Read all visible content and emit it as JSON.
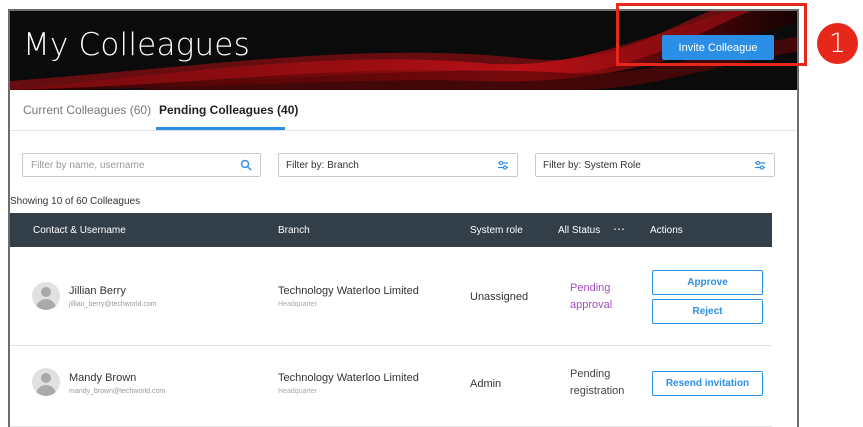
{
  "header": {
    "title": "My Colleagues",
    "invite_button": "Invite Colleague"
  },
  "tabs": [
    {
      "label": "Current Colleagues (60)",
      "active": false
    },
    {
      "label": "Pending Colleagues (40)",
      "active": true
    }
  ],
  "filters": {
    "search_placeholder": "Filter by name, username",
    "branch_label": "Filter by: Branch",
    "role_label": "Filter by: System Role"
  },
  "showing_text": "Showing 10 of 60 Colleagues",
  "table": {
    "columns": [
      "Contact & Username",
      "Branch",
      "System role",
      "All Status",
      "Actions"
    ],
    "status_menu_icon": "ellipsis-icon",
    "rows": [
      {
        "name": "Jillian Berry",
        "email": "jillian_berry@techworld.com",
        "branch": "Technology Waterloo Limited",
        "branch_sub": "Headquarter",
        "role": "Unassigned",
        "status_line1": "Pending",
        "status_line2": "approval",
        "actions": [
          "Approve",
          "Reject"
        ]
      },
      {
        "name": "Mandy Brown",
        "email": "mandy_brown@techworld.com",
        "branch": "Technology Waterloo Limited",
        "branch_sub": "Headquarter",
        "role": "Admin",
        "status_line1": "Pending",
        "status_line2": "registration",
        "actions": [
          "Resend invitation"
        ]
      }
    ]
  },
  "callout": {
    "number": "1"
  },
  "colors": {
    "accent": "#2b8fe6",
    "header_bg": "#323e48",
    "pending_approval": "#a24fbf",
    "callout": "#e8271b"
  }
}
